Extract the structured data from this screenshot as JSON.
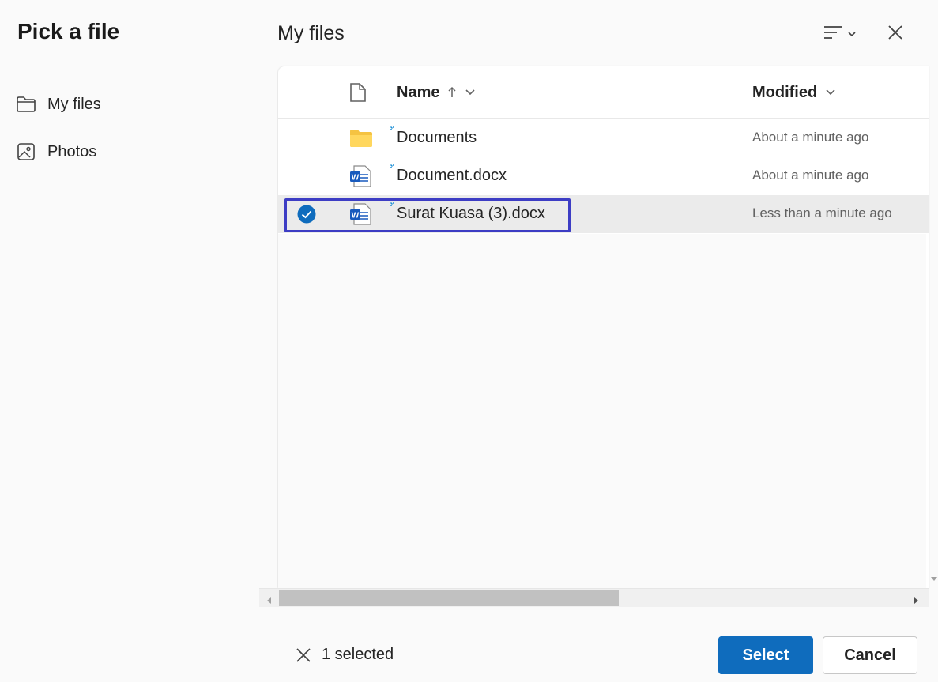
{
  "dialog": {
    "title": "Pick a file"
  },
  "sidebar": {
    "items": [
      {
        "label": "My files",
        "icon": "folder-icon"
      },
      {
        "label": "Photos",
        "icon": "image-icon"
      }
    ]
  },
  "main": {
    "title": "My files",
    "columns": {
      "name": "Name",
      "modified": "Modified"
    },
    "files": [
      {
        "name": "Documents",
        "modified": "About a minute ago",
        "type": "folder",
        "selected": false
      },
      {
        "name": "Document.docx",
        "modified": "About a minute ago",
        "type": "word",
        "selected": false
      },
      {
        "name": "Surat Kuasa (3).docx",
        "modified": "Less than a minute ago",
        "type": "word",
        "selected": true
      }
    ]
  },
  "footer": {
    "selected_text": "1 selected",
    "select_label": "Select",
    "cancel_label": "Cancel"
  },
  "colors": {
    "accent": "#0f6cbd",
    "highlight_box": "#3d3dc4",
    "folder": "#f5c342",
    "word": "#185abd"
  }
}
